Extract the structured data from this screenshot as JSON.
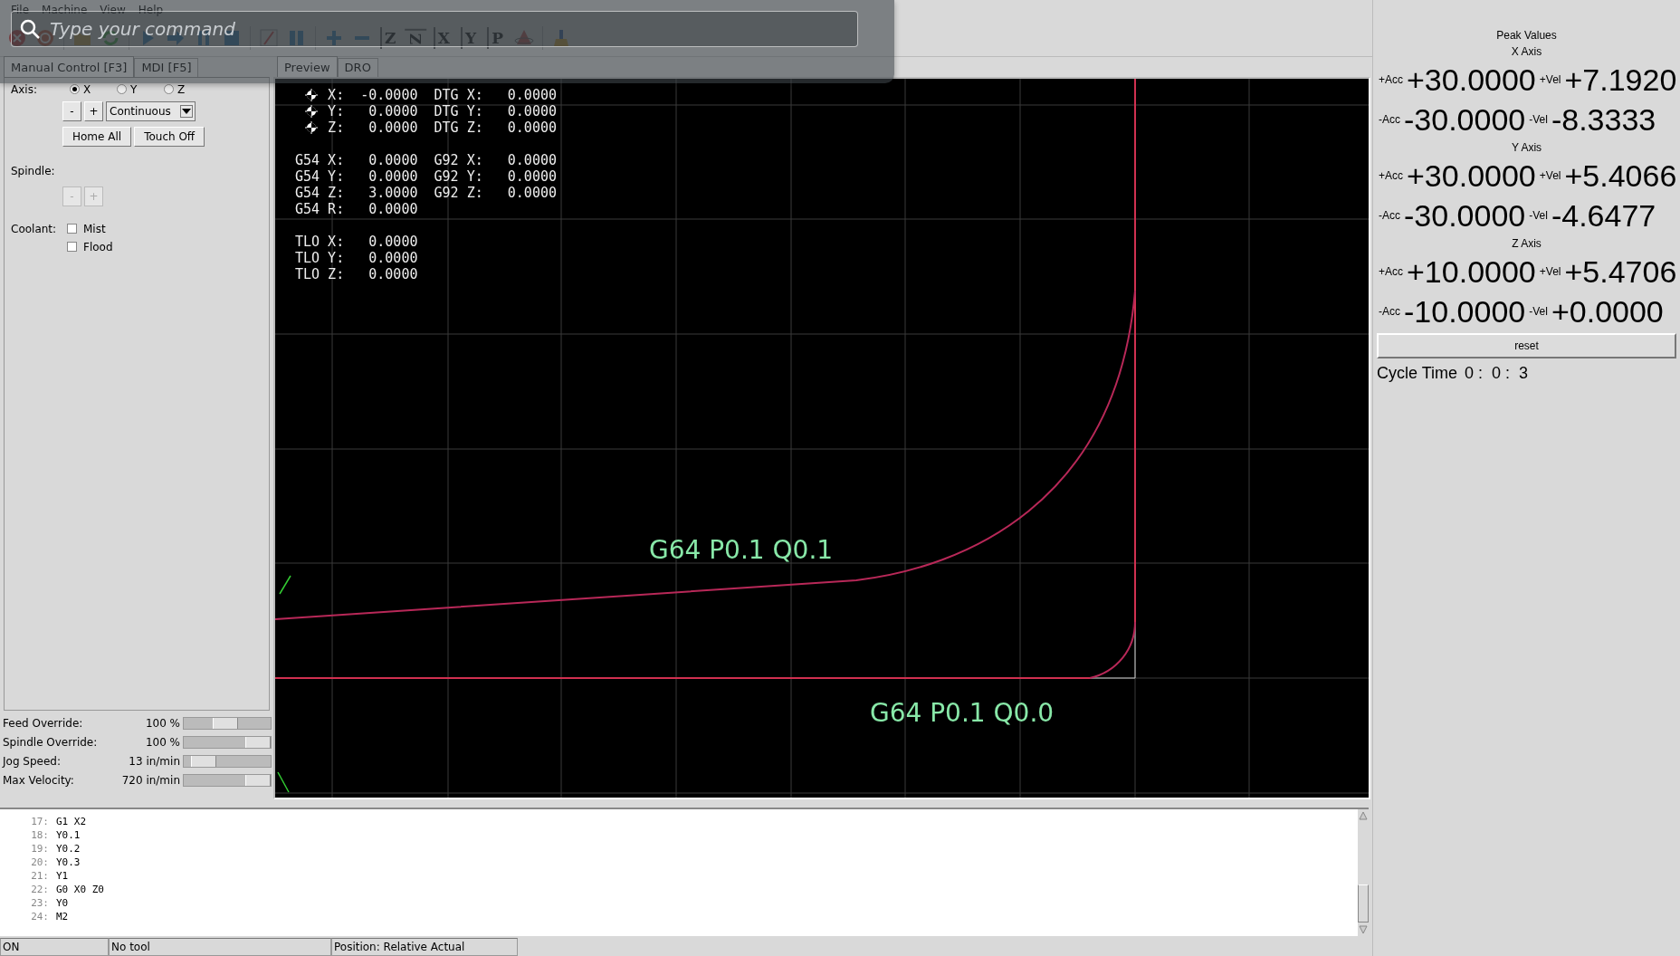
{
  "menu": [
    "File",
    "Machine",
    "View",
    "Help"
  ],
  "toolbar_views": [
    {
      "label": "Z",
      "kind": "plain"
    },
    {
      "label": "Z",
      "kind": "rotated"
    },
    {
      "label": "X",
      "kind": "plain"
    },
    {
      "label": "Y",
      "kind": "plain"
    },
    {
      "label": "P",
      "kind": "plain"
    }
  ],
  "command_palette": {
    "placeholder": "Type your command"
  },
  "left_tabs": [
    {
      "label": "Manual Control [F3]",
      "selected": true
    },
    {
      "label": "MDI [F5]",
      "selected": false
    }
  ],
  "manual": {
    "axis_label": "Axis:",
    "axes": [
      {
        "label": "X",
        "selected": true
      },
      {
        "label": "Y",
        "selected": false
      },
      {
        "label": "Z",
        "selected": false
      }
    ],
    "jog_minus": "-",
    "jog_plus": "+",
    "increment": "Continuous",
    "home_button": "Home All",
    "touch_off_button": "Touch Off",
    "spindle_label": "Spindle:",
    "spindle_buttons": [
      {
        "label": "-",
        "disabled": true
      },
      {
        "label": "+",
        "disabled": true
      }
    ],
    "coolant_label": "Coolant:",
    "coolant": [
      {
        "label": "Mist",
        "checked": false
      },
      {
        "label": "Flood",
        "checked": false
      }
    ]
  },
  "overrides": [
    {
      "label": "Feed Override:",
      "value": "100 %",
      "level": 0.47
    },
    {
      "label": "Spindle Override:",
      "value": "100 %",
      "level": 1
    },
    {
      "label": "Jog Speed:",
      "value": "13 in/min",
      "level": 0.12
    },
    {
      "label": "Max Velocity:",
      "value": "720 in/min",
      "level": 1
    }
  ],
  "preview_tabs": [
    {
      "label": "Preview",
      "selected": true
    },
    {
      "label": "DRO",
      "selected": false
    }
  ],
  "dro": [
    {
      "lines": [
        {
          "kind": "homed",
          "text": "X:  -0.0000  DTG X:   0.0000"
        },
        {
          "kind": "homed",
          "text": "Y:   0.0000  DTG Y:   0.0000"
        },
        {
          "kind": "homed",
          "text": "Z:   0.0000  DTG Z:   0.0000"
        }
      ]
    },
    {
      "lines": [
        {
          "kind": "plain",
          "text": "G54 X:   0.0000  G92 X:   0.0000"
        },
        {
          "kind": "plain",
          "text": "G54 Y:   0.0000  G92 Y:   0.0000"
        },
        {
          "kind": "plain",
          "text": "G54 Z:   3.0000  G92 Z:   0.0000"
        },
        {
          "kind": "plain",
          "text": "G54 R:   0.0000"
        }
      ]
    },
    {
      "lines": [
        {
          "kind": "plain",
          "text": "TLO X:   0.0000"
        },
        {
          "kind": "plain",
          "text": "TLO Y:   0.0000"
        },
        {
          "kind": "plain",
          "text": "TLO Z:   0.0000"
        }
      ]
    }
  ],
  "plot_labels": [
    "G64 P0.1 Q0.1",
    "G64 P0.1 Q0.0"
  ],
  "peak": {
    "title": "Peak Values",
    "axes": [
      {
        "title": "X Axis",
        "rows": [
          {
            "acc_label": "+Acc",
            "acc": "+30.0000",
            "vel_label": "+Vel",
            "vel": "+7.1920"
          },
          {
            "acc_label": "-Acc",
            "acc": "-30.0000",
            "vel_label": "-Vel",
            "vel": "-8.3333"
          }
        ]
      },
      {
        "title": "Y Axis",
        "rows": [
          {
            "acc_label": "+Acc",
            "acc": "+30.0000",
            "vel_label": "+Vel",
            "vel": "+5.4066"
          },
          {
            "acc_label": "-Acc",
            "acc": "-30.0000",
            "vel_label": "-Vel",
            "vel": "-4.6477"
          }
        ]
      },
      {
        "title": "Z Axis",
        "rows": [
          {
            "acc_label": "+Acc",
            "acc": "+10.0000",
            "vel_label": "+Vel",
            "vel": "+5.4706"
          },
          {
            "acc_label": "-Acc",
            "acc": "-10.0000",
            "vel_label": "-Vel",
            "vel": "+0.0000"
          }
        ]
      }
    ],
    "reset_button": "reset",
    "cycle_label": "Cycle Time",
    "cycle_value": "0 :  0 :  3"
  },
  "gcode": [
    {
      "number": "17:",
      "code": "G1 X2"
    },
    {
      "number": "18:",
      "code": "Y0.1"
    },
    {
      "number": "19:",
      "code": "Y0.2"
    },
    {
      "number": "20:",
      "code": "Y0.3"
    },
    {
      "number": "21:",
      "code": "Y1"
    },
    {
      "number": "22:",
      "code": "G0 X0 Z0"
    },
    {
      "number": "23:",
      "code": "Y0"
    },
    {
      "number": "24:",
      "code": "M2"
    }
  ],
  "status_bar": [
    "ON",
    "No tool",
    "Position: Relative Actual"
  ]
}
